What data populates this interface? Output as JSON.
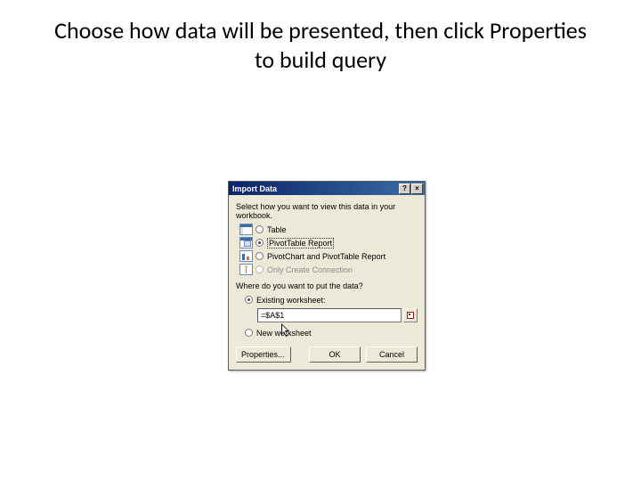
{
  "slide": {
    "title": "Choose how data will be presented, then click Properties to build query"
  },
  "dialog": {
    "title": "Import Data",
    "help_symbol": "?",
    "close_symbol": "×",
    "view_section": "Select how you want to view this data in your workbook.",
    "options": {
      "table": "Table",
      "pivot": "PivotTable Report",
      "pivotchart": "PivotChart and PivotTable Report",
      "connection": "Only Create Connection"
    },
    "location_section": "Where do you want to put the data?",
    "existing_label": "Existing worksheet:",
    "cell_ref": "=$A$1",
    "new_label": "New worksheet",
    "buttons": {
      "properties": "Properties...",
      "ok": "OK",
      "cancel": "Cancel"
    },
    "state": {
      "view_selected": "pivot",
      "location_selected": "existing"
    }
  }
}
